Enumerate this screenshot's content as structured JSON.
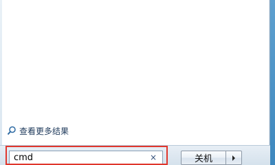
{
  "start_menu": {
    "see_more_results": "查看更多结果",
    "search": {
      "value": "cmd",
      "placeholder": ""
    },
    "clear_glyph": "×",
    "shutdown_label": "关机"
  },
  "colors": {
    "highlight_border": "#e0362c",
    "frame_blue": "#3a86b8",
    "link_text": "#1e395b"
  },
  "icons": [
    "search-icon",
    "clear-icon",
    "arrow-right-icon"
  ]
}
